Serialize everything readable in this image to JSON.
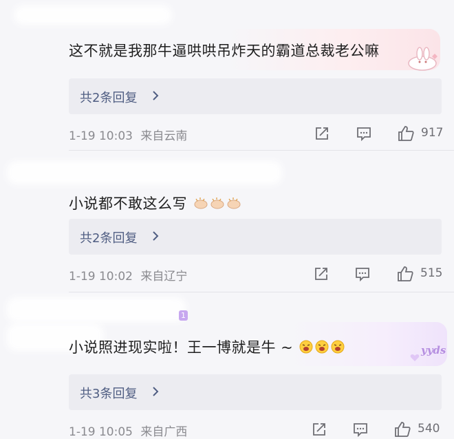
{
  "comments": [
    {
      "text": "这不就是我那牛逼哄哄吊炸天的霸道总裁老公嘛",
      "reply_label": "共2条回复",
      "time": "1-19 10:03",
      "location": "来自云南",
      "likes": "917"
    },
    {
      "text": "小说都不敢这么写",
      "reply_label": "共2条回复",
      "time": "1-19 10:02",
      "location": "来自辽宁",
      "likes": "515"
    },
    {
      "text": "小说照进现实啦！王一博就是牛 ~",
      "reply_label": "共3条回复",
      "time": "1-19 10:05",
      "location": "来自广西",
      "likes": "540",
      "deco_text": "yyds",
      "badge": "1"
    }
  ],
  "icons": {
    "share": "share-icon",
    "comment": "comment-icon",
    "like": "thumbs-up-icon",
    "chevron": "chevron-right-icon",
    "clap": "clapping-hands-emoji",
    "face": "excited-face-emoji"
  },
  "colors": {
    "background": "#f6f6f9",
    "reply_box": "#ececf1",
    "reply_text": "#4f5d82",
    "meta_text": "#8a8a8f"
  }
}
